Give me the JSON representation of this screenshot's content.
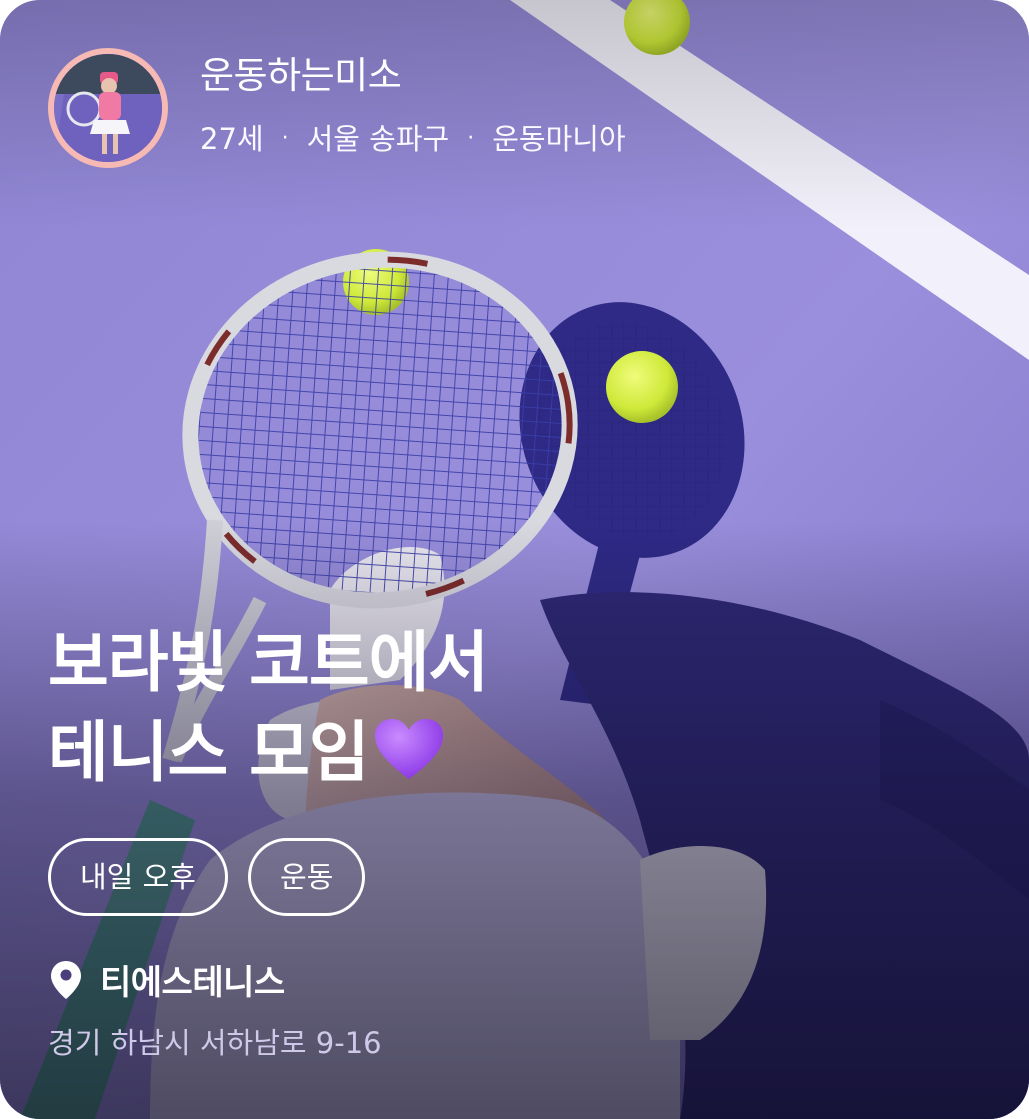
{
  "profile": {
    "nickname": "운동하는미소",
    "age": "27세",
    "region": "서울 송파구",
    "category": "운동마니아",
    "separator": "·"
  },
  "meeting": {
    "title_line1": "보라빛 코트에서",
    "title_line2": "테니스 모임",
    "title_emoji": "purple-heart-icon"
  },
  "tags": [
    "내일 오후",
    "운동"
  ],
  "location": {
    "name": "티에스테니스",
    "address": "경기 하남시 서하남로 9-16",
    "icon": "location-pin-icon"
  },
  "colors": {
    "court": "#8e82cf",
    "court_line": "#f2f0fa",
    "ball": "#d8ef3e",
    "avatar_ring": "#f6b9b4",
    "heart": "#9b4df0",
    "address_text": "#cfc8e8"
  }
}
